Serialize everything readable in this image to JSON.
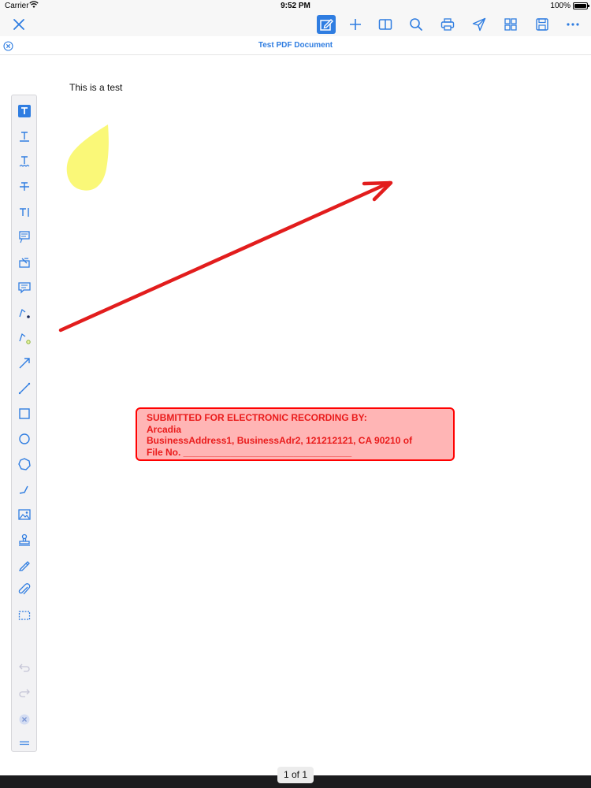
{
  "status_bar": {
    "carrier": "Carrier",
    "time": "9:52 PM",
    "battery_percent": "100%",
    "battery_level": 1.0
  },
  "toolbar": {
    "close_icon": "close-icon",
    "actions": [
      {
        "name": "annotate",
        "icon": "edit-icon",
        "active": true
      },
      {
        "name": "add",
        "icon": "plus-icon"
      },
      {
        "name": "book-view",
        "icon": "book-icon"
      },
      {
        "name": "search",
        "icon": "search-icon"
      },
      {
        "name": "print",
        "icon": "print-icon"
      },
      {
        "name": "send",
        "icon": "send-icon"
      },
      {
        "name": "thumbnails",
        "icon": "grid-icon"
      },
      {
        "name": "save",
        "icon": "save-icon"
      },
      {
        "name": "more",
        "icon": "more-icon"
      }
    ],
    "accent_color": "#2f7de1"
  },
  "document": {
    "title": "Test PDF Document",
    "body_text": "This is a test",
    "stamp": {
      "line1": "SUBMITTED FOR ELECTRONIC RECORDING BY:",
      "line2": "Arcadia",
      "line3": "BusinessAddress1, BusinessAdr2, 121212121, CA 90210   of",
      "line4": "File No. ________________________________",
      "color": "#ea1b1b"
    },
    "highlight_color": "#faf878",
    "arrow_color": "#e21d1d"
  },
  "tool_palette": [
    "text-box-icon",
    "underline-icon",
    "squiggly-icon",
    "strikethrough-icon",
    "insert-text-icon",
    "callout-icon",
    "text-stamp-icon",
    "note-icon",
    "pen-icon",
    "highlighter-icon",
    "arrow-icon",
    "line-icon",
    "rectangle-icon",
    "circle-icon",
    "polygon-icon",
    "polyline-icon",
    "image-icon",
    "stamp-icon",
    "signature-icon",
    "attachment-icon",
    "selection-icon",
    "undo-icon",
    "redo-icon",
    "clear-icon",
    "drag-handle-icon"
  ],
  "pagination": {
    "label": "1 of 1"
  }
}
